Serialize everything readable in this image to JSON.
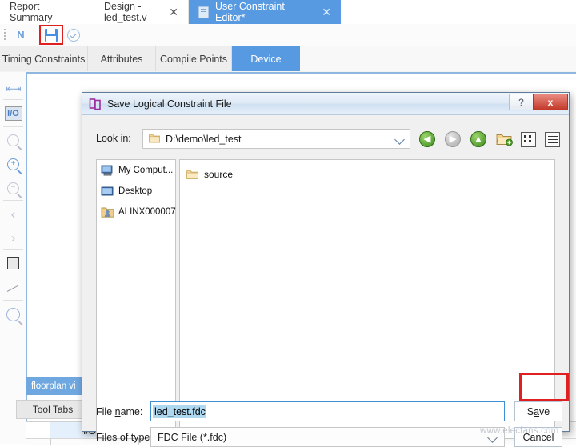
{
  "app": {
    "tabs": [
      {
        "label": "Report Summary",
        "closable": false,
        "active": false
      },
      {
        "label": "Design - led_test.v",
        "closable": true,
        "active": false
      },
      {
        "label": "User Constraint Editor*",
        "closable": true,
        "active": true
      }
    ],
    "tab_close_glyph": "✕",
    "toolbar": {
      "new_label": "N",
      "save_icon": "save-floppy-icon",
      "check_icon": "check-circle-icon"
    },
    "subtabs": [
      {
        "label": "Timing Constraints",
        "active": false
      },
      {
        "label": "Attributes",
        "active": false
      },
      {
        "label": "Compile Points",
        "active": false
      },
      {
        "label": "Device",
        "active": true
      }
    ],
    "rail_icons": [
      "fit-width-icon",
      "io-ports-icon",
      "zoom-select-icon",
      "zoom-in-icon",
      "zoom-out-icon",
      "back-chevron-icon",
      "forward-chevron-icon",
      "select-rectangle-icon",
      "measure-icon",
      "search-icon"
    ],
    "panel_tabs": {
      "floorplan": "floorplan vi",
      "tool_tabs": "Tool Tabs",
      "io_tab": "I/O N"
    }
  },
  "dialog": {
    "title": "Save Logical Constraint File",
    "title_icon": "app-logo-icon",
    "window_buttons": {
      "help": "?",
      "close": "x"
    },
    "lookin": {
      "label": "Look in:",
      "value": "D:\\demo\\led_test",
      "icon": "folder-icon",
      "caret": "chevron-down-icon"
    },
    "nav_buttons": [
      {
        "name": "back-button",
        "glyph": "◀",
        "style": "green"
      },
      {
        "name": "forward-button",
        "glyph": "▶",
        "style": "gray"
      },
      {
        "name": "parent-folder-button",
        "glyph": "▲",
        "style": "green"
      },
      {
        "name": "new-folder-button",
        "glyph": "",
        "style": "folder"
      },
      {
        "name": "icon-view-button",
        "glyph": "",
        "style": "grid"
      },
      {
        "name": "detail-view-button",
        "glyph": "",
        "style": "list"
      }
    ],
    "places": [
      {
        "label": "My Comput...",
        "icon": "computer-icon"
      },
      {
        "label": "Desktop",
        "icon": "desktop-icon"
      },
      {
        "label": "ALINX000007",
        "icon": "user-folder-icon"
      }
    ],
    "files": [
      {
        "name": "source",
        "icon": "folder-icon"
      }
    ],
    "filename": {
      "label_pre": "File ",
      "label_key": "n",
      "label_post": "ame:",
      "value": "led_test.fdc",
      "selected": true
    },
    "filetype": {
      "label": "Files of type:",
      "value": "FDC File (*.fdc)",
      "caret": "chevron-down-icon"
    },
    "buttons": {
      "save_pre": "S",
      "save_key": "a",
      "save_post": "ve",
      "cancel": "Cancel"
    }
  },
  "watermark": "www.elecfans.com",
  "colors": {
    "accent_blue": "#579ae1",
    "highlight_red": "#e02020",
    "selection_blue": "#add8f0",
    "titlebar_blue": "#dfeaf6"
  }
}
